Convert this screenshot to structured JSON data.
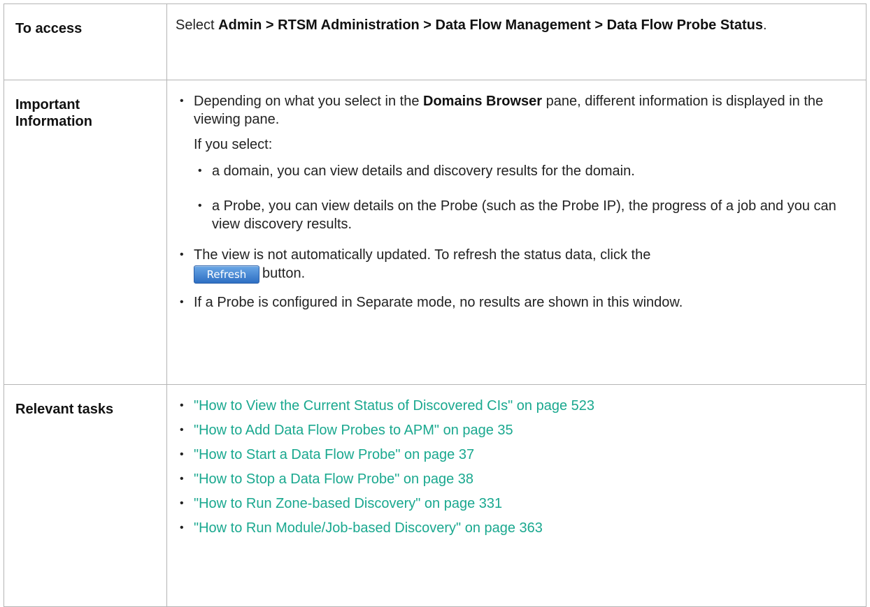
{
  "rows": {
    "access": {
      "label": "To access",
      "prefix": "Select ",
      "path": "Admin > RTSM Administration > Data Flow Management > Data Flow Probe Status",
      "suffix": "."
    },
    "important": {
      "label": "Important Information",
      "b1_pre": "Depending on what you select in the ",
      "b1_bold": "Domains Browser",
      "b1_post": " pane, different information is displayed in the viewing pane.",
      "if_select": "If you select:",
      "sub1": "a domain, you can view details and discovery results for the domain.",
      "sub2": "a Probe, you can view details on the Probe (such as the Probe IP), the progress of a job and you can view discovery results.",
      "b2_pre": "The view is not automatically updated. To refresh the status data, click the",
      "refresh_label": "Refresh",
      "b2_post": "button.",
      "b3": "If a Probe is configured in Separate mode, no results are shown in this window."
    },
    "tasks": {
      "label": "Relevant tasks",
      "links": [
        "\"How to View the Current Status of Discovered CIs\" on page 523",
        "\"How to Add Data Flow Probes to APM\" on page 35",
        "\"How to Start a Data Flow Probe\" on page 37",
        "\"How to Stop a Data Flow Probe\" on page 38",
        "\"How to Run Zone-based Discovery\" on page 331",
        "\"How to Run Module/Job-based Discovery\" on page 363"
      ]
    }
  },
  "colors": {
    "link": "#1aa88f",
    "border": "#b5b5b5",
    "button": "#2e6fc3"
  }
}
